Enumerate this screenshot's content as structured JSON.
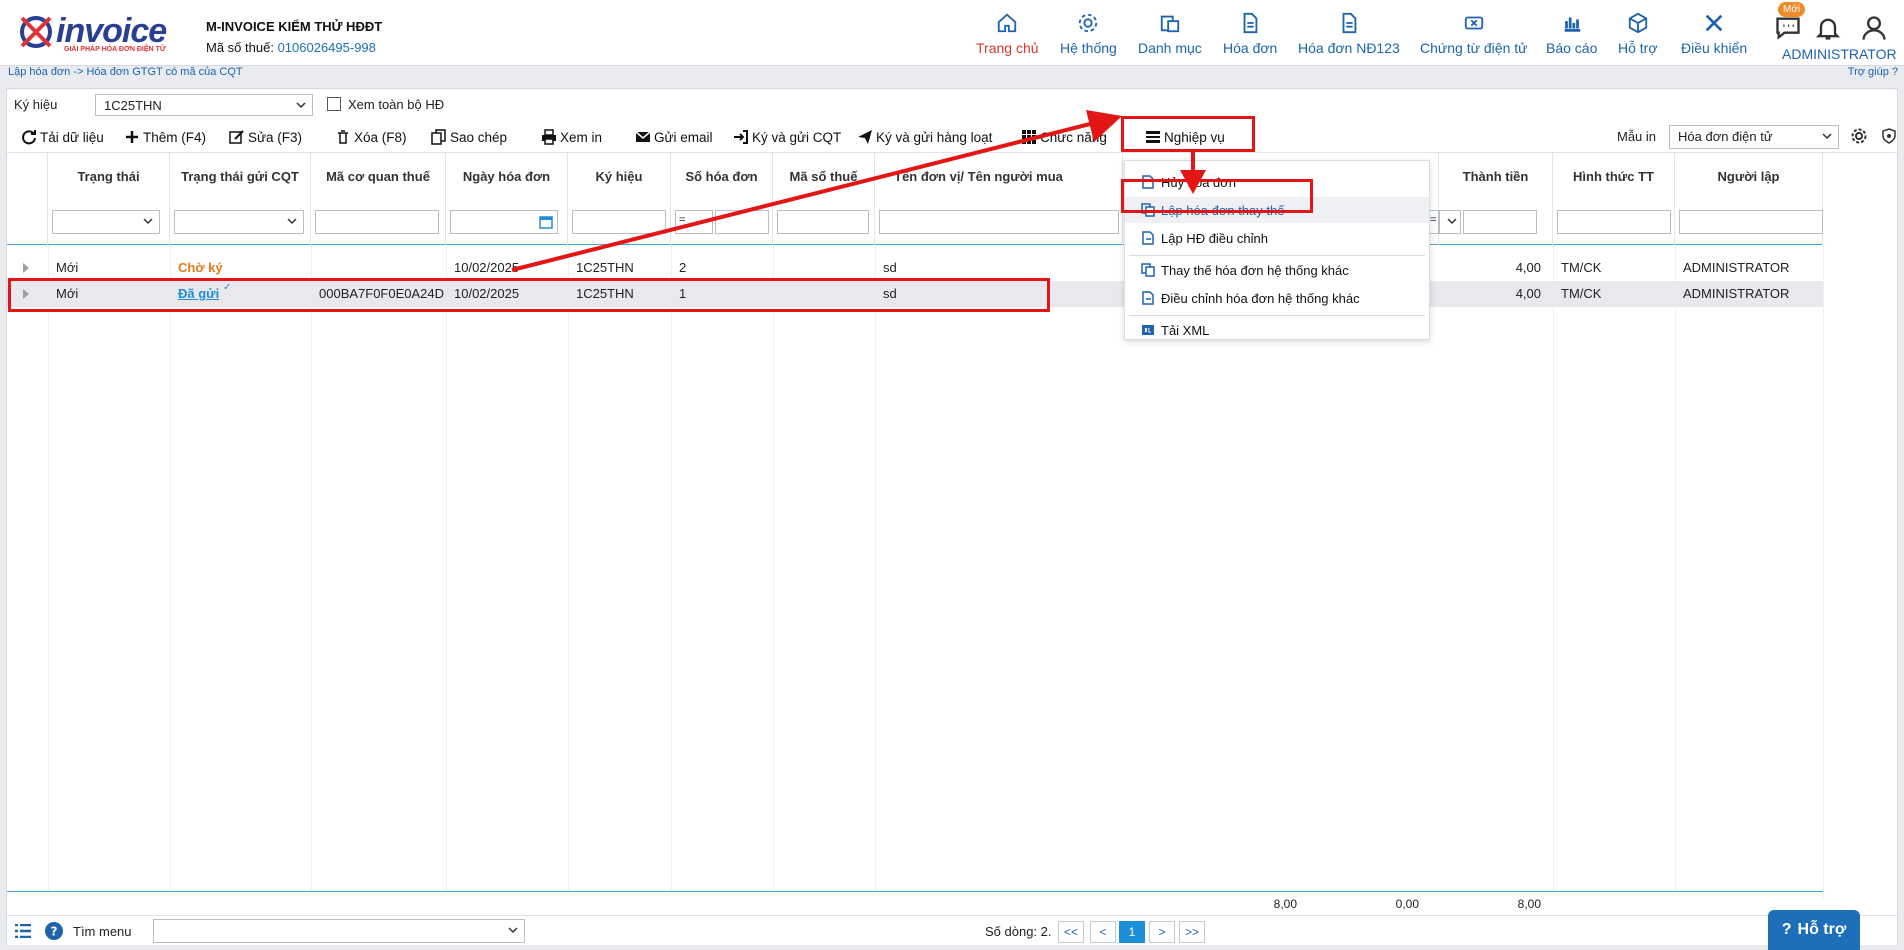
{
  "header": {
    "company": "M-INVOICE KIỂM THỬ HĐĐT",
    "tax_label": "Mã số thuế:",
    "tax_value": "0106026495-998",
    "logo_text": "invoice",
    "logo_sub": "GIẢI PHÁP HÓA ĐƠN ĐIỆN TỬ",
    "nav": [
      {
        "label": "Trang chủ",
        "icon": "home-icon"
      },
      {
        "label": "Hệ thống",
        "icon": "gear-icon"
      },
      {
        "label": "Danh mục",
        "icon": "folder-icon"
      },
      {
        "label": "Hóa đơn",
        "icon": "document-icon"
      },
      {
        "label": "Hóa đơn NĐ123",
        "icon": "document-icon"
      },
      {
        "label": "Chứng từ điện tử",
        "icon": "ticket-icon"
      },
      {
        "label": "Báo cáo",
        "icon": "bar-chart-icon"
      },
      {
        "label": "Hỗ trợ",
        "icon": "cube-icon"
      },
      {
        "label": "Điều khiển",
        "icon": "tools-icon"
      }
    ],
    "badge": "Mới",
    "user": "ADMINISTRATOR"
  },
  "breadcrumb": "Lập hóa đơn -> Hóa đơn GTGT có mã của CQT",
  "help_link": "Trợ giúp",
  "filters": {
    "kyhieu_label": "Ký hiệu",
    "kyhieu_value": "1C25THN",
    "view_all_label": "Xem toàn bộ HĐ",
    "mauin_label": "Mẫu in",
    "mauin_value": "Hóa đơn điện tử"
  },
  "toolbar": {
    "reload": "Tải dữ liệu",
    "add": "Thêm (F4)",
    "edit": "Sửa (F3)",
    "delete": "Xóa (F8)",
    "copy": "Sao chép",
    "print": "Xem in",
    "email": "Gửi email",
    "sign_send": "Ký và gửi CQT",
    "sign_batch": "Ký và gửi hàng loạt",
    "functions": "Chức năng",
    "operations": "Nghiệp vụ"
  },
  "columns": {
    "status": "Trạng thái",
    "cqt_status": "Trạng thái gửi CQT",
    "tax_code": "Mã cơ quan thuế",
    "date": "Ngày hóa đơn",
    "symbol": "Ký hiệu",
    "number": "Số hóa đơn",
    "buyer_tax": "Mã số thuế",
    "buyer_name": "Tên đơn vị/ Tên người mua",
    "total": "Thành tiền",
    "payment": "Hình thức TT",
    "creator": "Người lập"
  },
  "filter_op": "=",
  "rows": [
    {
      "status": "Mới",
      "cqt_status": "Chờ ký",
      "tax_code": "",
      "date": "10/02/2025",
      "symbol": "1C25THN",
      "number": "2",
      "buyer_tax": "",
      "buyer_name": "sd",
      "total": "4,00",
      "payment": "TM/CK",
      "creator": "ADMINISTRATOR"
    },
    {
      "status": "Mới",
      "cqt_status": "Đã gửi",
      "tax_code": "000BA7F0F0E0A24D",
      "date": "10/02/2025",
      "symbol": "1C25THN",
      "number": "1",
      "buyer_tax": "",
      "buyer_name": "sd",
      "total": "4,00",
      "payment": "TM/CK",
      "creator": "ADMINISTRATOR"
    }
  ],
  "summary": {
    "a": "8,00",
    "b": "0,00",
    "c": "8,00"
  },
  "dropdown": {
    "items": [
      "Hủy hóa đơn",
      "Lập hóa đơn thay thế",
      "Lập HĐ điều chỉnh",
      "Thay thế hóa đơn hệ thống khác",
      "Điều chỉnh hóa đơn hệ thống khác",
      "Tải XML"
    ]
  },
  "bottom": {
    "menu_search": "Tìm menu",
    "row_count": "Số dòng: 2.",
    "first": "<<",
    "prev": "<",
    "page": "1",
    "next": ">",
    "last": ">>"
  },
  "support_button": "Hỗ trợ",
  "colors": {
    "accent": "#1d63ad",
    "active_nav": "#d63a2a",
    "annotation": "#e41515",
    "pending": "#e07b1f"
  }
}
